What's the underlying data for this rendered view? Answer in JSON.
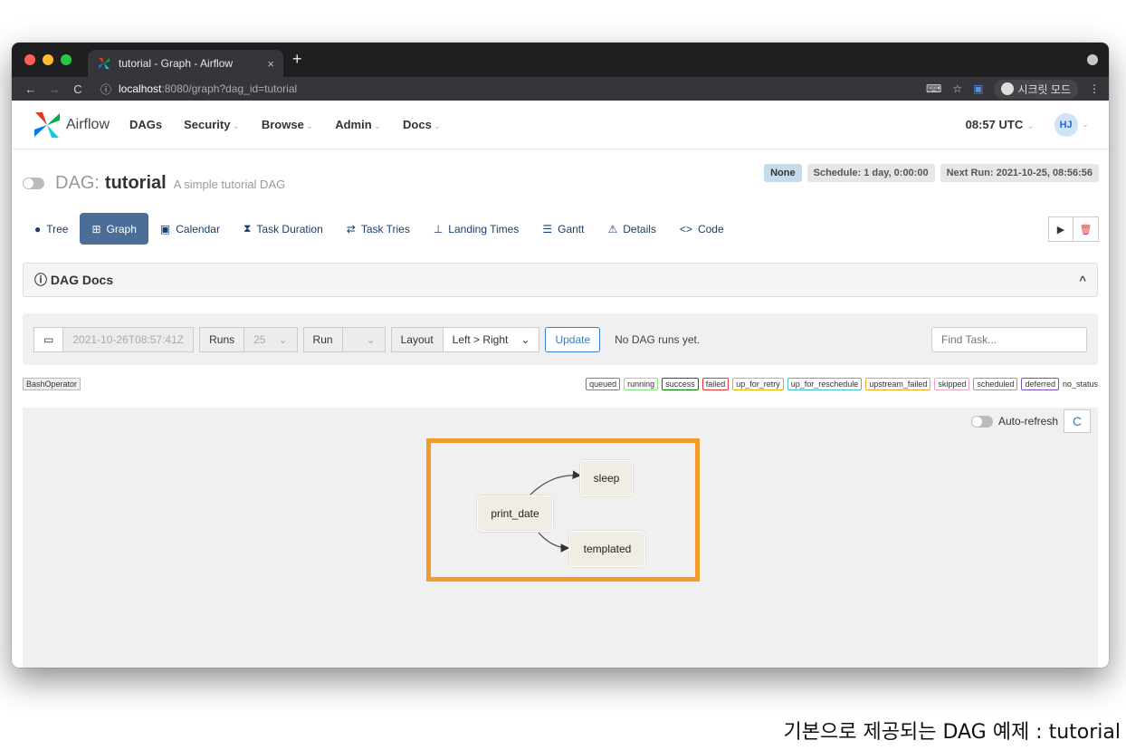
{
  "browser": {
    "tab_title": "tutorial - Graph - Airflow",
    "tab_close": "×",
    "new_tab": "+",
    "url_host": "localhost",
    "url_rest": ":8080/graph?dag_id=tutorial",
    "incognito_label": "시크릿 모드"
  },
  "navbar": {
    "brand": "Airflow",
    "menu": [
      {
        "label": "DAGs",
        "caret": ""
      },
      {
        "label": "Security",
        "caret": "⌄"
      },
      {
        "label": "Browse",
        "caret": "⌄"
      },
      {
        "label": "Admin",
        "caret": "⌄"
      },
      {
        "label": "Docs",
        "caret": "⌄"
      }
    ],
    "time": "08:57 UTC",
    "avatar": "HJ"
  },
  "header": {
    "dag_prefix": "DAG:",
    "dag_id": "tutorial",
    "description": "A simple tutorial DAG",
    "badge_none": "None",
    "schedule": "Schedule: 1 day, 0:00:00",
    "next_run": "Next Run: 2021-10-25, 08:56:56"
  },
  "tabs": [
    {
      "label": "Tree",
      "icon": "●"
    },
    {
      "label": "Graph",
      "icon": "⊞"
    },
    {
      "label": "Calendar",
      "icon": "▣"
    },
    {
      "label": "Task Duration",
      "icon": "⧗"
    },
    {
      "label": "Task Tries",
      "icon": "⇄"
    },
    {
      "label": "Landing Times",
      "icon": "⊥"
    },
    {
      "label": "Gantt",
      "icon": "☰"
    },
    {
      "label": "Details",
      "icon": "⚠"
    },
    {
      "label": "Code",
      "icon": "<>"
    }
  ],
  "docs_panel": {
    "label": "ⓘ DAG Docs",
    "toggle": "^"
  },
  "controls": {
    "date_value": "2021-10-26T08:57:41Z",
    "runs_label": "Runs",
    "runs_value": "25",
    "run_label": "Run",
    "layout_label": "Layout",
    "layout_value": "Left > Right",
    "update_label": "Update",
    "no_runs": "No DAG runs yet.",
    "find_placeholder": "Find Task..."
  },
  "legend": {
    "operator": "BashOperator",
    "states": [
      {
        "label": "queued",
        "color": "#808080"
      },
      {
        "label": "running",
        "color": "#7ee87e"
      },
      {
        "label": "success",
        "color": "#008000"
      },
      {
        "label": "failed",
        "color": "#e53935"
      },
      {
        "label": "up_for_retry",
        "color": "#f0b400"
      },
      {
        "label": "up_for_reschedule",
        "color": "#40c0d0"
      },
      {
        "label": "upstream_failed",
        "color": "#f5a623"
      },
      {
        "label": "skipped",
        "color": "#f4a7c0"
      },
      {
        "label": "scheduled",
        "color": "#9a9a9a"
      },
      {
        "label": "deferred",
        "color": "#7b4fc9"
      }
    ],
    "no_status": "no_status"
  },
  "graph": {
    "auto_refresh": "Auto-refresh",
    "refresh_icon": "C",
    "nodes": {
      "print_date": "print_date",
      "sleep": "sleep",
      "templated": "templated"
    }
  },
  "caption": "기본으로 제공되는 DAG 예제 : tutorial"
}
